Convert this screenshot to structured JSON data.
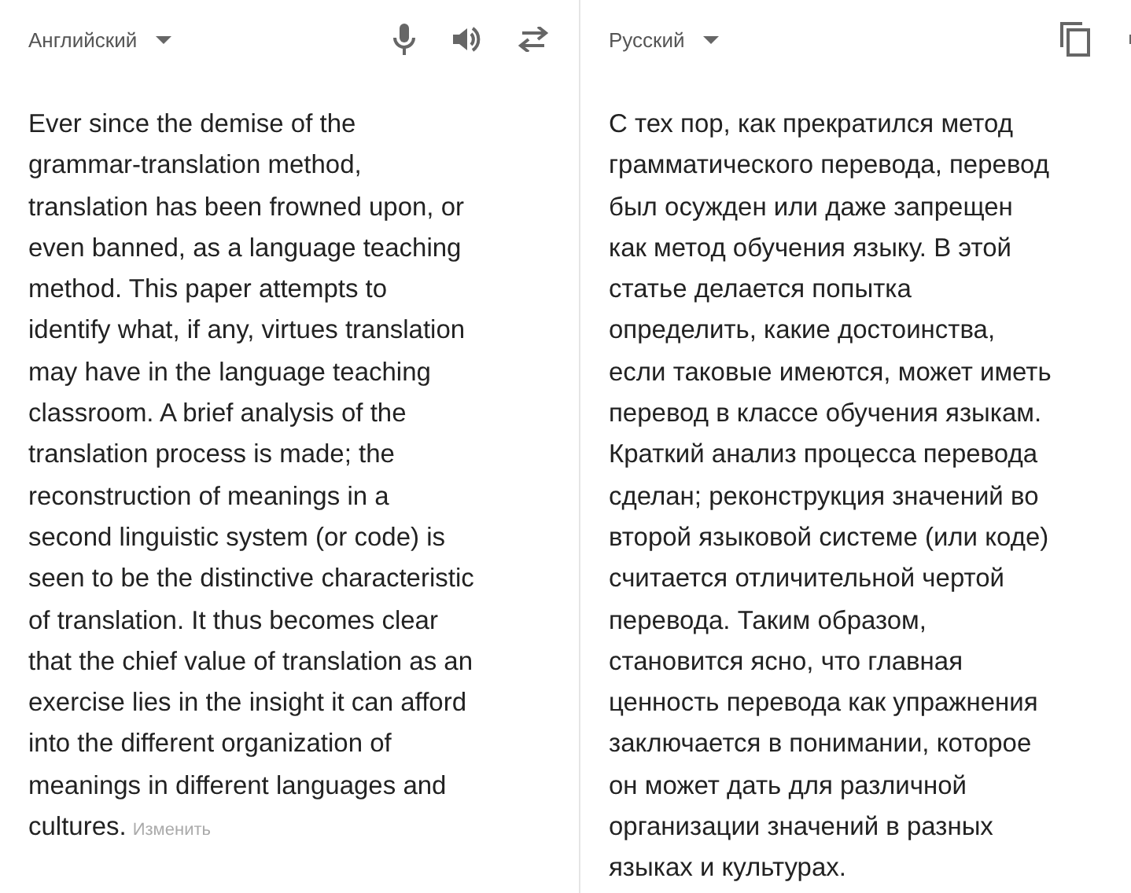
{
  "source": {
    "language": "Английский",
    "lines": [
      "Ever since the demise of the",
      "grammar-translation method,",
      "translation has been frowned upon, or",
      "even banned, as a language teaching",
      "method. This paper attempts to",
      "identify what, if any, virtues translation",
      "may have in the language teaching",
      "classroom. A brief analysis of the",
      "translation process is made; the",
      "reconstruction of meanings in a",
      "second linguistic system (or code) is",
      "seen to be the distinctive characteristic",
      "of translation. It thus becomes clear",
      "that the chief value of translation as an",
      "exercise lies in the insight it can afford",
      "into the different organization of",
      "meanings in different languages and",
      "cultures."
    ],
    "edit_link": "Изменить"
  },
  "target": {
    "language": "Русский",
    "lines": [
      "С тех пор, как прекратился метод",
      "грамматического перевода, перевод",
      "был осужден или даже запрещен",
      "как метод обучения языку. В этой",
      "статье делается попытка",
      "определить, какие достоинства,",
      "если таковые имеются, может иметь",
      "перевод в классе обучения языкам.",
      "Краткий анализ процесса перевода",
      "сделан; реконструкция значений во",
      "второй языковой системе (или коде)",
      "считается отличительной чертой",
      "перевода. Таким образом,",
      "становится ясно, что главная",
      "ценность перевода как упражнения",
      "заключается в понимании, которое",
      "он может дать для различной",
      "организации значений в разных",
      "языках и культурах."
    ]
  }
}
